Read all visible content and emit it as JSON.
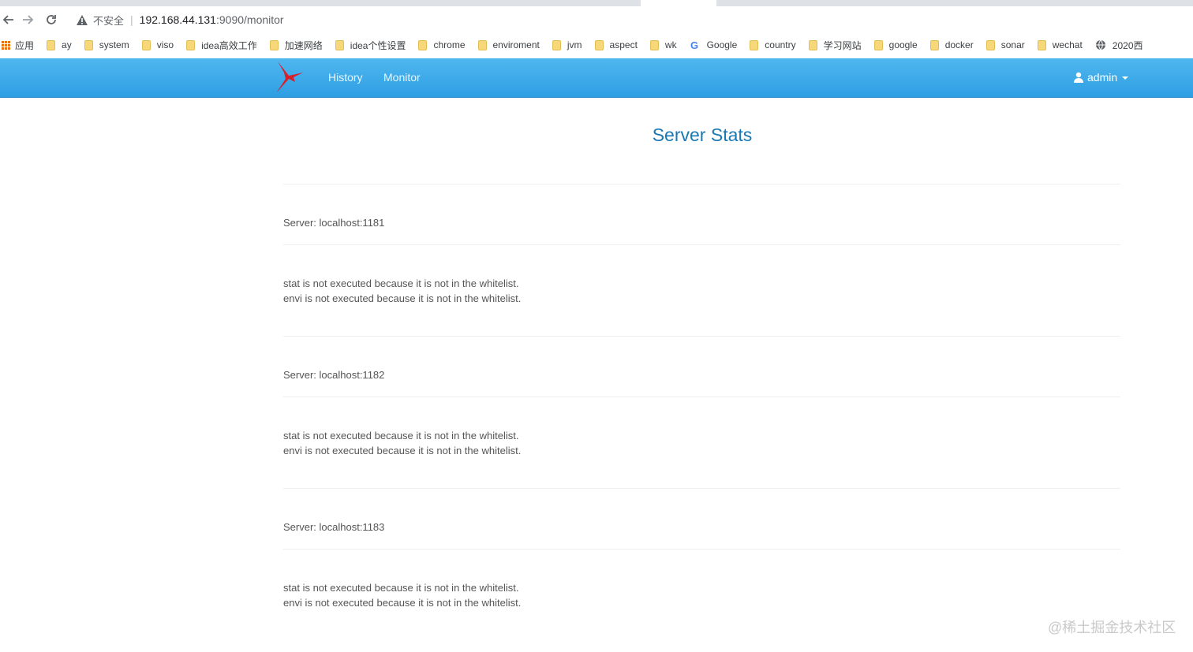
{
  "browser": {
    "insecure_label": "不安全",
    "url_host": "192.168.44.131",
    "url_rest": ":9090/monitor",
    "bookmarks": [
      {
        "label": "应用",
        "icon": "apps-icon"
      },
      {
        "label": "ay",
        "icon": "folder-icon"
      },
      {
        "label": "system",
        "icon": "folder-icon"
      },
      {
        "label": "viso",
        "icon": "folder-icon"
      },
      {
        "label": "idea高效工作",
        "icon": "folder-icon"
      },
      {
        "label": "加速网络",
        "icon": "folder-icon"
      },
      {
        "label": "idea个性设置",
        "icon": "folder-icon"
      },
      {
        "label": "chrome",
        "icon": "folder-icon"
      },
      {
        "label": "enviroment",
        "icon": "folder-icon"
      },
      {
        "label": "jvm",
        "icon": "folder-icon"
      },
      {
        "label": "aspect",
        "icon": "folder-icon"
      },
      {
        "label": "wk",
        "icon": "folder-icon"
      },
      {
        "label": "Google",
        "icon": "google-icon"
      },
      {
        "label": "country",
        "icon": "folder-icon"
      },
      {
        "label": "学习网站",
        "icon": "folder-icon"
      },
      {
        "label": "google",
        "icon": "folder-icon"
      },
      {
        "label": "docker",
        "icon": "folder-icon"
      },
      {
        "label": "sonar",
        "icon": "folder-icon"
      },
      {
        "label": "wechat",
        "icon": "folder-icon"
      },
      {
        "label": "2020西",
        "icon": "globe-icon"
      }
    ]
  },
  "navbar": {
    "links": [
      "History",
      "Monitor"
    ],
    "user": "admin",
    "brand_color": "#3aa8e8"
  },
  "page": {
    "title": "Server Stats",
    "servers": [
      {
        "label": "Server: localhost:1181",
        "messages": [
          "stat is not executed because it is not in the whitelist.",
          "envi is not executed because it is not in the whitelist."
        ]
      },
      {
        "label": "Server: localhost:1182",
        "messages": [
          "stat is not executed because it is not in the whitelist.",
          "envi is not executed because it is not in the whitelist."
        ]
      },
      {
        "label": "Server: localhost:1183",
        "messages": [
          "stat is not executed because it is not in the whitelist.",
          "envi is not executed because it is not in the whitelist."
        ]
      }
    ]
  },
  "watermark": "@稀土掘金技术社区"
}
